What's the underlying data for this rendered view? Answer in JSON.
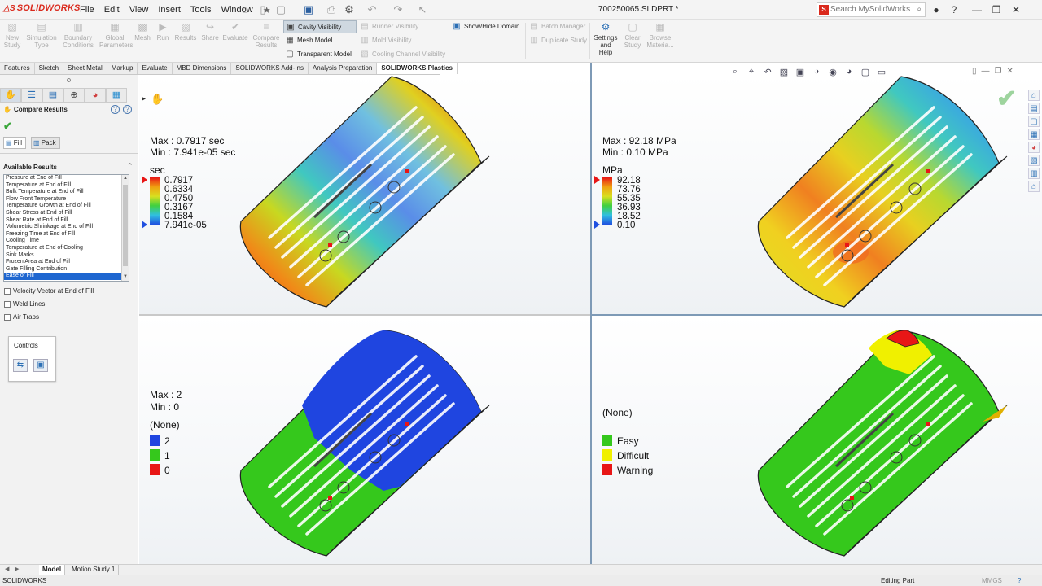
{
  "app": {
    "logo": "SOLIDWORKS",
    "document_title": "700250065.SLDPRT *"
  },
  "menu": [
    "File",
    "Edit",
    "View",
    "Insert",
    "Tools",
    "Window"
  ],
  "search": {
    "placeholder": "Search MySolidWorks"
  },
  "ribbon": {
    "disabled_buttons": [
      {
        "label": "New Study",
        "icon": "new-study-icon"
      },
      {
        "label": "Simulation Type",
        "icon": "simulation-type-icon"
      },
      {
        "label": "Boundary Conditions",
        "icon": "boundary-conditions-icon"
      },
      {
        "label": "Global Parameters",
        "icon": "global-parameters-icon"
      },
      {
        "label": "Mesh",
        "icon": "mesh-icon"
      },
      {
        "label": "Run",
        "icon": "run-icon"
      },
      {
        "label": "Results",
        "icon": "results-icon"
      },
      {
        "label": "Share",
        "icon": "share-icon"
      },
      {
        "label": "Evaluate",
        "icon": "evaluate-icon"
      },
      {
        "label": "Compare Results",
        "icon": "compare-results-icon"
      }
    ],
    "visibility": {
      "cavity": "Cavity Visibility",
      "mesh_model": "Mesh Model",
      "transparent": "Transparent Model",
      "runner": "Runner Visibility",
      "mold": "Mold Visibility",
      "cooling": "Cooling Channel Visibility",
      "show_hide_domain": "Show/Hide Domain",
      "batch_manager": "Batch Manager",
      "duplicate_study": "Duplicate Study"
    },
    "settings": "Settings and Help",
    "clear_study": "Clear Study",
    "browse_materials": "Browse Materia..."
  },
  "tabs": [
    "Features",
    "Sketch",
    "Sheet Metal",
    "Markup",
    "Evaluate",
    "MBD Dimensions",
    "SOLIDWORKS Add-Ins",
    "Analysis Preparation",
    "SOLIDWORKS Plastics"
  ],
  "active_tab_index": 8,
  "panel": {
    "title": "Compare Results",
    "subtabs": [
      "Fill",
      "Pack"
    ],
    "available_results_header": "Available Results",
    "results": [
      "Pressure at End of Fill",
      "Temperature at End of Fill",
      "Bulk Temperature at End of Fill",
      "Flow Front Temperature",
      "Temperature Growth at End of Fill",
      "Shear Stress at End of Fill",
      "Shear Rate at End of Fill",
      "Volumetric Shrinkage at End of Fill",
      "Freezing Time at End of Fill",
      "Cooling Time",
      "Temperature at End of Cooling",
      "Sink Marks",
      "Frozen Area at End of Fill",
      "Gate Filling Contribution",
      "Ease of Fill"
    ],
    "selected_result": "Ease of Fill",
    "checkboxes": [
      "Velocity Vector at End of Fill",
      "Weld Lines",
      "Air Traps"
    ],
    "controls_label": "Controls"
  },
  "viewports": {
    "top_left": {
      "max": "Max : 0.7917 sec",
      "min": "Min : 7.941e-05 sec",
      "unit": "sec",
      "ticks": [
        "0.7917",
        "0.6334",
        "0.4750",
        "0.3167",
        "0.1584",
        "7.941e-05"
      ]
    },
    "top_right": {
      "max": "Max : 92.18 MPa",
      "min": "Min : 0.10 MPa",
      "unit": "MPa",
      "ticks": [
        "92.18",
        "73.76",
        "55.35",
        "36.93",
        "18.52",
        "0.10"
      ]
    },
    "bottom_left": {
      "max": "Max : 2",
      "min": "Min : 0",
      "title": "(None)",
      "legend": [
        {
          "label": "2",
          "color": "#1f45e0"
        },
        {
          "label": "1",
          "color": "#35c81c"
        },
        {
          "label": "0",
          "color": "#e81616"
        }
      ]
    },
    "bottom_right": {
      "title": "(None)",
      "legend": [
        {
          "label": "Easy",
          "color": "#35c81c"
        },
        {
          "label": "Difficult",
          "color": "#f0f000"
        },
        {
          "label": "Warning",
          "color": "#e81616"
        }
      ]
    }
  },
  "bottom_tabs": [
    "Model",
    "Motion Study 1"
  ],
  "status": {
    "left": "SOLIDWORKS",
    "mode": "Editing Part",
    "units": "MMGS"
  }
}
